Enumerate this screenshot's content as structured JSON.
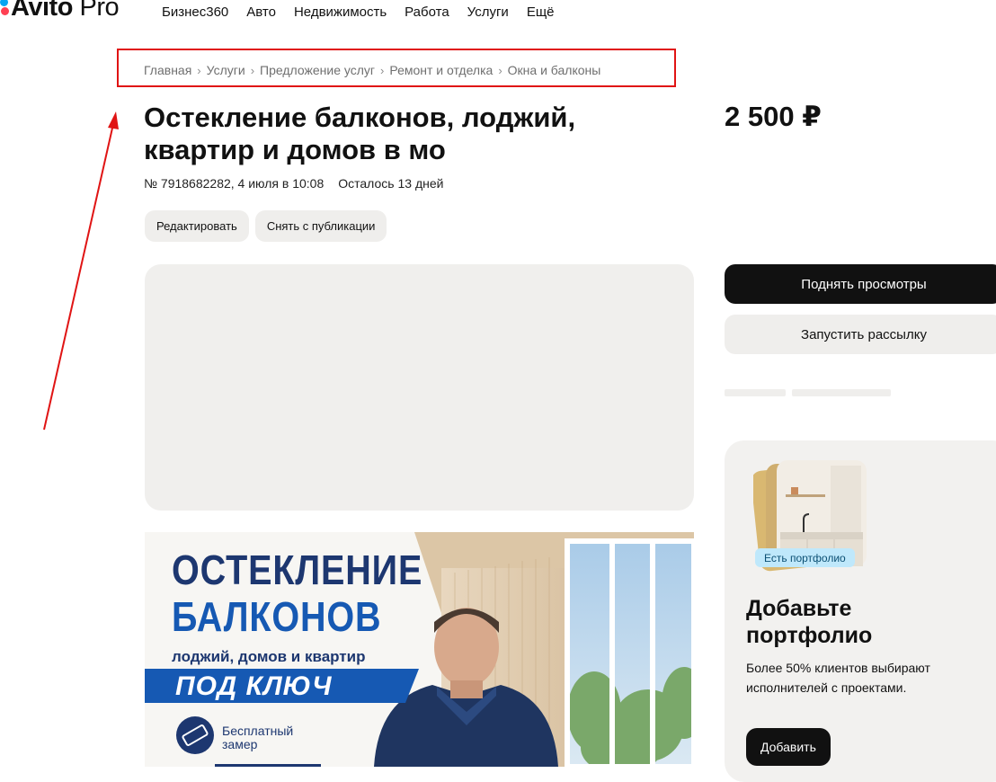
{
  "header": {
    "logo_main": "Avito",
    "logo_pro": "Pro",
    "nav": [
      "Бизнес360",
      "Авто",
      "Недвижимость",
      "Работа",
      "Услуги",
      "Ещё"
    ]
  },
  "breadcrumbs": [
    "Главная",
    "Услуги",
    "Предложение услуг",
    "Ремонт и отделка",
    "Окна и балконы"
  ],
  "listing": {
    "title": "Остекление балконов, лоджий, квартир и домов в мо",
    "number_date": "№ 7918682282, 4 июля в 10:08",
    "remaining": "Осталось 13 дней",
    "edit_label": "Редактировать",
    "unpublish_label": "Снять с публикации",
    "price": "2 500 ₽"
  },
  "banner": {
    "line1": "ОСТЕКЛЕНИЕ",
    "line2": "БАЛКОНОВ",
    "line3": "лоджий, домов и квартир",
    "line4": "ПОД КЛЮЧ",
    "free_line1": "Бесплатный",
    "free_line2": "замер"
  },
  "actions": {
    "boost_label": "Поднять просмотры",
    "mailing_label": "Запустить рассылку"
  },
  "promo": {
    "badge": "Есть портфолио",
    "title": "Добавьте портфолио",
    "text": "Более 50% клиентов выбирают исполнителей с проектами.",
    "button": "Добавить"
  },
  "colors": {
    "brand_blue": "#04a6f2",
    "brand_red": "#ff4053",
    "annotation_red": "#e01414",
    "banner_navy": "#1d3770",
    "banner_blue": "#1659b3"
  }
}
